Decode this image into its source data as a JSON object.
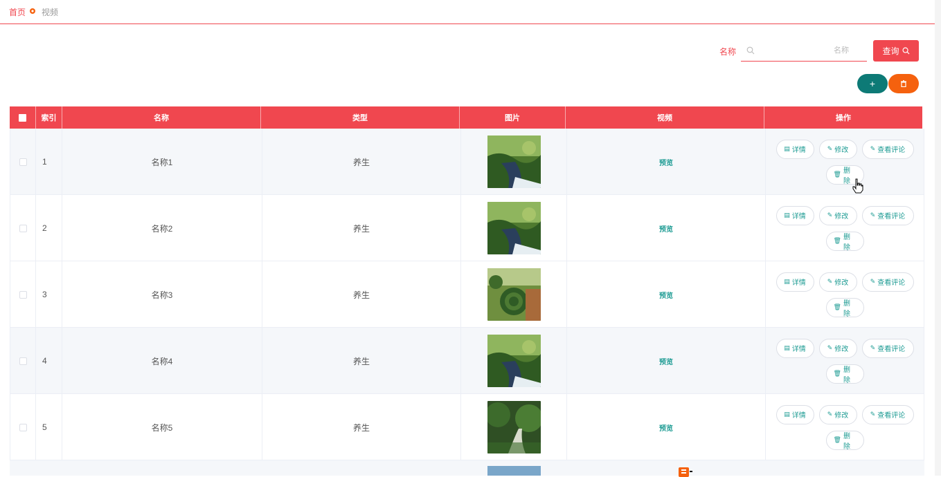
{
  "breadcrumb": {
    "home": "首页",
    "current": "视频"
  },
  "search": {
    "label": "名称",
    "placeholder": "名称",
    "value": "",
    "query_label": "查询"
  },
  "actions": {
    "add_icon": "plus-icon",
    "delete_icon": "trash-icon"
  },
  "colors": {
    "primary": "#f0474f",
    "teal": "#0d7a76",
    "orange": "#f5610e",
    "link": "#1f9c94"
  },
  "table": {
    "headers": {
      "index": "索引",
      "name": "名称",
      "type": "类型",
      "image": "图片",
      "video": "视频",
      "ops": "操作"
    },
    "rows": [
      {
        "index": "1",
        "name": "名称1",
        "type": "养生",
        "image": "waterfall-willow",
        "video": "预览"
      },
      {
        "index": "2",
        "name": "名称2",
        "type": "养生",
        "image": "waterfall-willow",
        "video": "预览"
      },
      {
        "index": "3",
        "name": "名称3",
        "type": "养生",
        "image": "garden-maze",
        "video": "预览"
      },
      {
        "index": "4",
        "name": "名称4",
        "type": "养生",
        "image": "waterfall-willow",
        "video": "预览"
      },
      {
        "index": "5",
        "name": "名称5",
        "type": "养生",
        "image": "garden-path",
        "video": "预览"
      }
    ],
    "ops": {
      "detail": "详情",
      "edit": "修改",
      "comments": "查看评论",
      "delete": "删除"
    }
  }
}
